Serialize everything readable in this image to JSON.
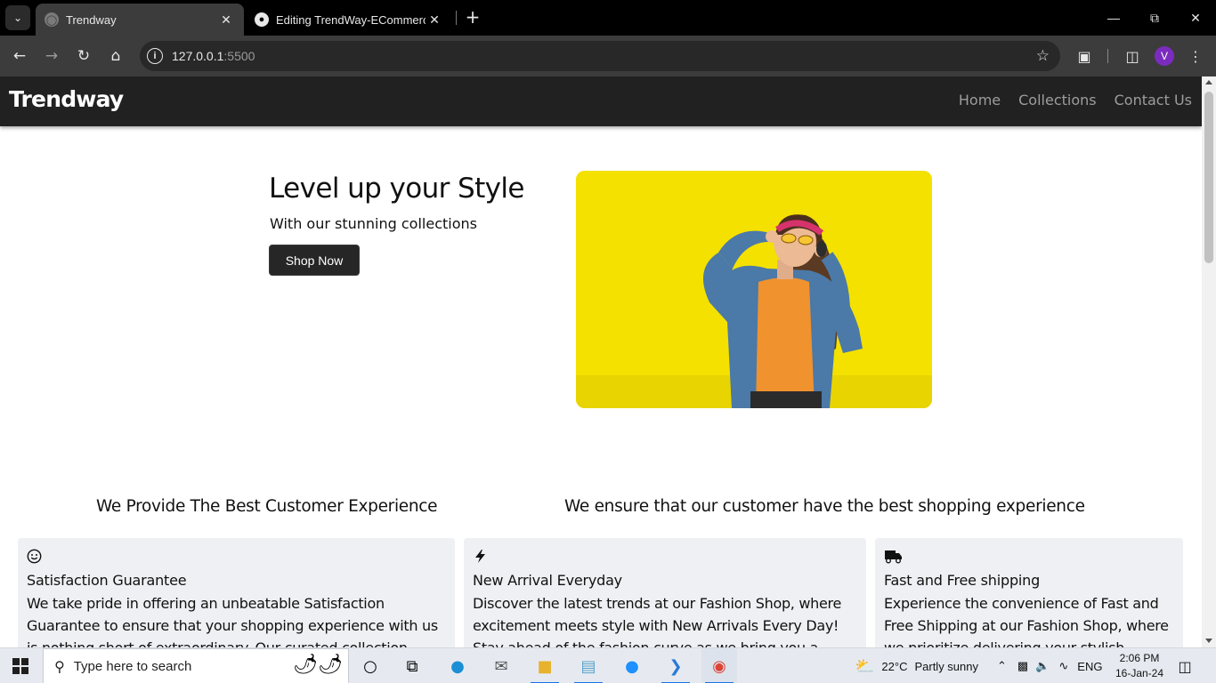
{
  "browser": {
    "tabs": [
      {
        "title": "Trendway",
        "active": true
      },
      {
        "title": "Editing TrendWay-ECommerce/",
        "active": false
      }
    ],
    "url_host": "127.0.0.1",
    "url_port": ":5500",
    "profile_initial": "V"
  },
  "site": {
    "brand": "Trendway",
    "nav": [
      "Home",
      "Collections",
      "Contact Us"
    ],
    "hero": {
      "title": "Level up your Style",
      "subtitle": "With our stunning collections",
      "cta": "Shop Now"
    },
    "headings": {
      "left": "We Provide The Best Customer Experience",
      "right": "We ensure that our customer have the best shopping experience"
    },
    "features": [
      {
        "icon": "smile-icon",
        "title": "Satisfaction Guarantee",
        "text": "We take pride in offering an unbeatable Satisfaction Guarantee to ensure that your shopping experience with us is nothing short of extraordinary. Our curated collection"
      },
      {
        "icon": "lightning-icon",
        "title": "New Arrival Everyday",
        "text": "Discover the latest trends at our Fashion Shop, where excitement meets style with New Arrivals Every Day! Stay ahead of the fashion curve as we bring you a"
      },
      {
        "icon": "truck-icon",
        "title": "Fast and Free shipping",
        "text": "Experience the convenience of Fast and Free Shipping at our Fashion Shop, where we prioritize delivering your stylish"
      }
    ]
  },
  "taskbar": {
    "search_placeholder": "Type here to search",
    "weather_temp": "22°C",
    "weather_text": "Partly sunny",
    "language": "ENG",
    "time": "2:06 PM",
    "date": "16-Jan-24"
  },
  "colors": {
    "nav_bg": "#212121",
    "nav_link": "#9d9d9d",
    "hero_image_bg": "#f4e100",
    "card_bg": "#eff0f3",
    "button_bg": "#262626"
  }
}
